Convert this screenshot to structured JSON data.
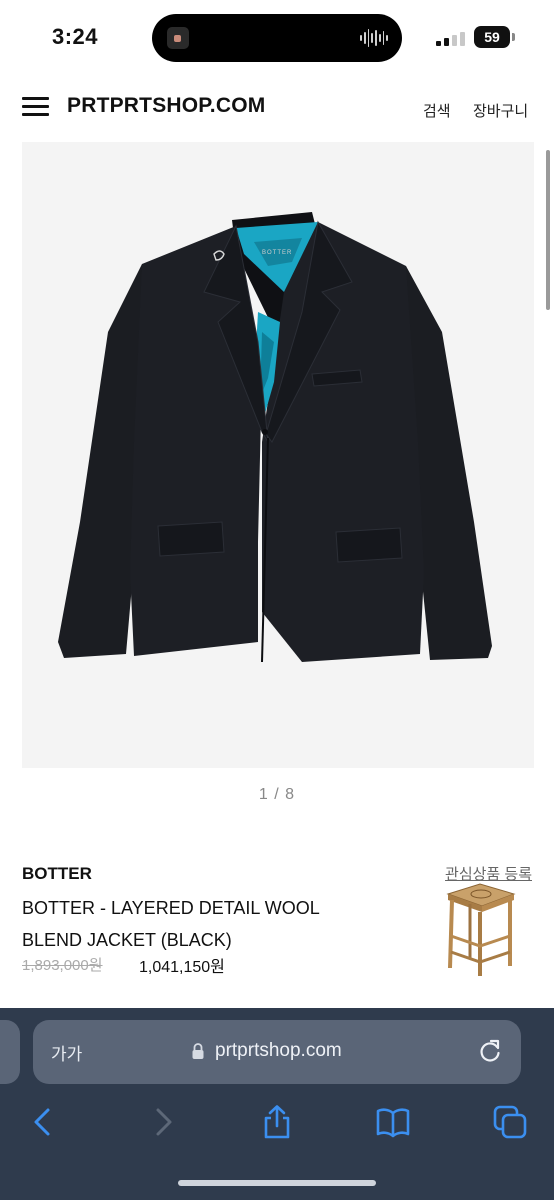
{
  "status_bar": {
    "time": "3:24",
    "battery": "59"
  },
  "header": {
    "logo": "PRTPRTSHOP.COM",
    "search": "검색",
    "cart": "장바구니"
  },
  "gallery": {
    "counter": "1 / 8",
    "jacket_label": "BOTTER"
  },
  "product": {
    "brand": "BOTTER",
    "wishlist": "관심상품 등록",
    "name": "BOTTER - LAYERED DETAIL WOOL BLEND JACKET (BLACK)",
    "original_price": "1,893,000원",
    "sale_price": "1,041,150원"
  },
  "browser": {
    "text_size_button": "가가",
    "url": "prtprtshop.com"
  },
  "colors": {
    "toolbar_bg": "#2f3b4d",
    "toolbar_accent": "#3b8ff0",
    "jacket": "#1b1d22",
    "lining": "#1aa6c4"
  }
}
